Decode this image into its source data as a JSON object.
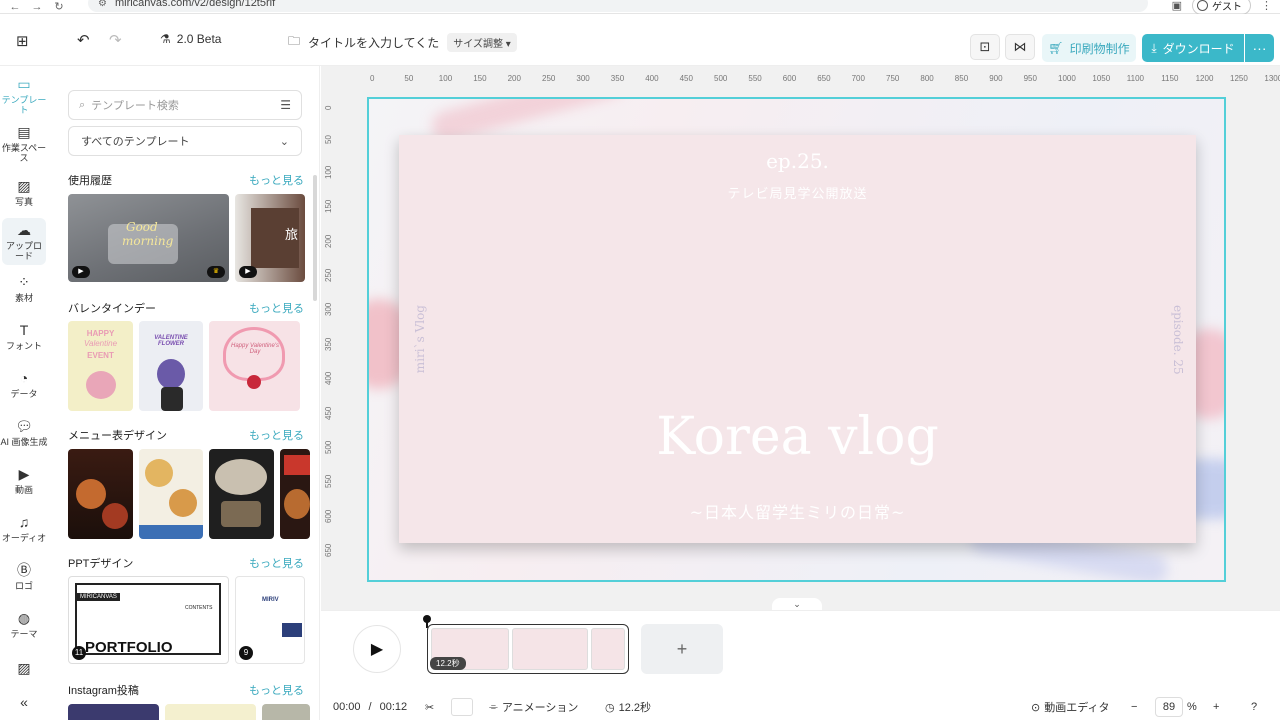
{
  "browser": {
    "url": "miricanvas.com/v2/design/12t5rif",
    "guest_label": "ゲスト"
  },
  "header": {
    "version_label": "2.0 Beta",
    "title_placeholder": "タイトルを入力してくた",
    "resize_label": "サイズ調整",
    "print_label": "印刷物制作",
    "download_label": "ダウンロード",
    "more_label": "···"
  },
  "rail": {
    "items": [
      {
        "label": "テンプレート",
        "icon": "template-icon"
      },
      {
        "label": "作業スペース",
        "icon": "workspace-icon"
      },
      {
        "label": "写真",
        "icon": "photo-icon"
      },
      {
        "label": "アップロード",
        "icon": "upload-icon"
      },
      {
        "label": "素材",
        "icon": "elements-icon"
      },
      {
        "label": "フォント",
        "icon": "font-icon"
      },
      {
        "label": "データ",
        "icon": "data-icon"
      },
      {
        "label": "AI 画像生成",
        "icon": "ai-image-icon"
      },
      {
        "label": "動画",
        "icon": "video-icon"
      },
      {
        "label": "オーディオ",
        "icon": "audio-icon"
      },
      {
        "label": "ロゴ",
        "icon": "logo-icon"
      },
      {
        "label": "テーマ",
        "icon": "theme-icon"
      }
    ]
  },
  "panel": {
    "search_placeholder": "テンプレート検索",
    "category_select": "すべてのテンプレート",
    "more_label": "もっと見る",
    "sections": [
      {
        "title": "使用履歴"
      },
      {
        "title": "バレンタインデー"
      },
      {
        "title": "メニュー表デザイン"
      },
      {
        "title": "PPTデザイン"
      },
      {
        "title": "Instagram投稿"
      }
    ],
    "thumb_texts": {
      "good_morning_line1": "Good",
      "good_morning_line2": "morning",
      "travel": "旅",
      "happy_valentine_1": "HAPPY",
      "happy_valentine_2": "Valentine",
      "happy_valentine_3": "EVENT",
      "valentine_flower": "VALENTINE FLOWER",
      "happy_valentines_day": "Happy Valentine's Day",
      "portfolio_brand": "MIRICANVAS",
      "portfolio_contents": "CONTENTS",
      "portfolio_title": "PORTFOLIO",
      "portfolio_badge": "11",
      "ppt2_badge": "9",
      "ppt2_brand": "MIRIV"
    }
  },
  "rulers": {
    "h": [
      "0",
      "50",
      "100",
      "150",
      "200",
      "250",
      "300",
      "350",
      "400",
      "450",
      "500",
      "550",
      "600",
      "650",
      "700",
      "750",
      "800",
      "850",
      "900",
      "950",
      "1000",
      "1050",
      "1100",
      "1150",
      "1200",
      "1250",
      "1300"
    ],
    "v": [
      "0",
      "50",
      "100",
      "150",
      "200",
      "250",
      "300",
      "350",
      "400",
      "450",
      "500",
      "550",
      "600",
      "650"
    ]
  },
  "design": {
    "episode": "ep.25.",
    "subtitle_top": "テレビ局見学公開放送",
    "left_vertical": "miri`s Vlog",
    "right_vertical": "episode. 25",
    "main_title": "Korea vlog",
    "subtitle_bottom": "~日本人留学生ミリの日常~"
  },
  "timeline": {
    "clip_duration": "12.2秒",
    "current_time": "00:00",
    "separator": "/",
    "total_time": "00:12",
    "animation_label": "アニメーション",
    "duration_label": "12.2秒",
    "editor_label": "動画エディタ",
    "zoom_value": "89",
    "zoom_unit": "%"
  },
  "colors": {
    "accent": "#3bb8c9",
    "selection": "#53cfd8",
    "card": "#f5e6e9"
  }
}
